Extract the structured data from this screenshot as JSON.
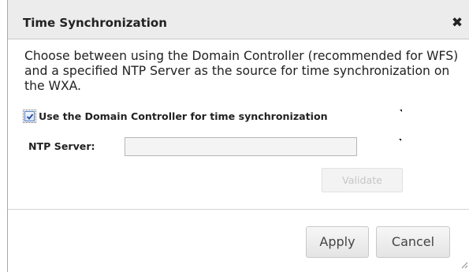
{
  "dialog": {
    "title": "Time Synchronization",
    "close_glyph": "✖",
    "description": "Choose between using the Domain Controller (recommended for WFS) and a specified NTP Server as the source for time synchronization on the WXA.",
    "use_domain_controller": {
      "label": "Use the Domain Controller for time synchronization",
      "checked": true
    },
    "ntp_server": {
      "label": "NTP Server:",
      "value": "",
      "placeholder": ""
    },
    "validate_label": "Validate",
    "apply_label": "Apply",
    "cancel_label": "Cancel"
  },
  "icons": {
    "close": "close-icon",
    "checkmark": "checkmark-icon",
    "resize": "resize-grip-icon"
  },
  "colors": {
    "titlebar": "#ececec",
    "text": "#222222",
    "checkbox_border": "#4e7cc1",
    "disabled_text": "#c6c6c6"
  }
}
